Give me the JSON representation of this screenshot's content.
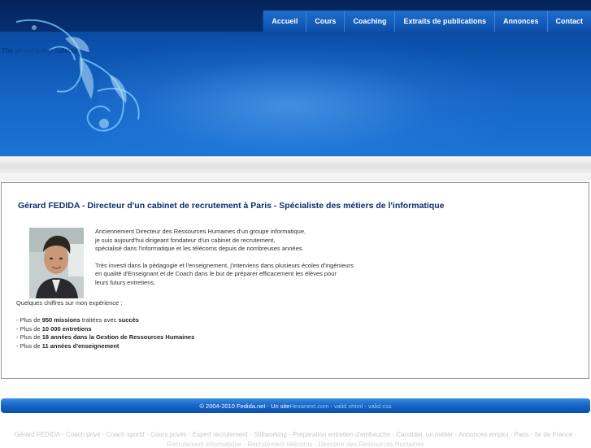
{
  "header": {
    "tagline_parts": [
      "The ",
      "gérard fedida",
      " collects"
    ]
  },
  "nav": {
    "items": [
      {
        "label": "Accueil"
      },
      {
        "label": "Cours"
      },
      {
        "label": "Coaching"
      },
      {
        "label": "Extraits de publications"
      },
      {
        "label": "Annonces"
      },
      {
        "label": "Contact"
      }
    ]
  },
  "main": {
    "heading": "Gérard FEDIDA   -   Directeur d'un cabinet de recrutement à Paris   -  Spécialiste des métiers de l'informatique",
    "bio_para1": [
      "Anciennement Directeur des Ressources Humaines d'un groupe informatique,",
      "je suis aujourd'hui dirigeant fondateur d'un cabinet de recrutement,",
      "spécialisé dans l'informatique et les télécoms depuis de nombreuses années."
    ],
    "bio_para2": [
      "Très investi dans la pédagogie et l'enseignement, j'interviens dans plusieurs écoles d'ingénieurs",
      "en qualité d'Enseignant et de Coach dans le but de préparer efficacement les élèves pour",
      "leurs futurs entretiens."
    ],
    "stats_intro": "Quelques chiffres sur mon expérience :",
    "stats": [
      {
        "pre": "- Plus de ",
        "bold": "950 missions",
        "mid": " traitées avec ",
        "bold2": "succès"
      },
      {
        "pre": "- Plus de ",
        "bold": "10 000 entretiens",
        "mid": "",
        "bold2": ""
      },
      {
        "pre": "- Plus de ",
        "bold": "18 années dans la Gestion de Ressources Humaines",
        "mid": "",
        "bold2": ""
      },
      {
        "pre": "- Plus de ",
        "bold": "11 années d'enseignement",
        "mid": "",
        "bold2": ""
      }
    ]
  },
  "footer": {
    "copyright": "© 2004-2010 Fedida.net - Un site ",
    "link_site": "Hexanext.com",
    "sep": " - ",
    "link_xhtml": "valid xhtml",
    "link_css": "valid css"
  },
  "keywords": {
    "line1": "Gérard FEDIDA - Coach privé - Coach sportif - Cours privés - Expert recrutement - Stiltworking - Préparation entretien d'embauche - Candidat, un métier - Annonces emploi - Paris - Ile de France -",
    "line2": "Recrutement informatique - Recrutement télécoms - Directeur des Ressources Humaines"
  },
  "colors": {
    "header_top": "#04245a",
    "header_blue": "#1564c4",
    "heading": "#0b2f70",
    "footer_blue": "#1664c8",
    "footer_link": "#8fd0ff"
  }
}
